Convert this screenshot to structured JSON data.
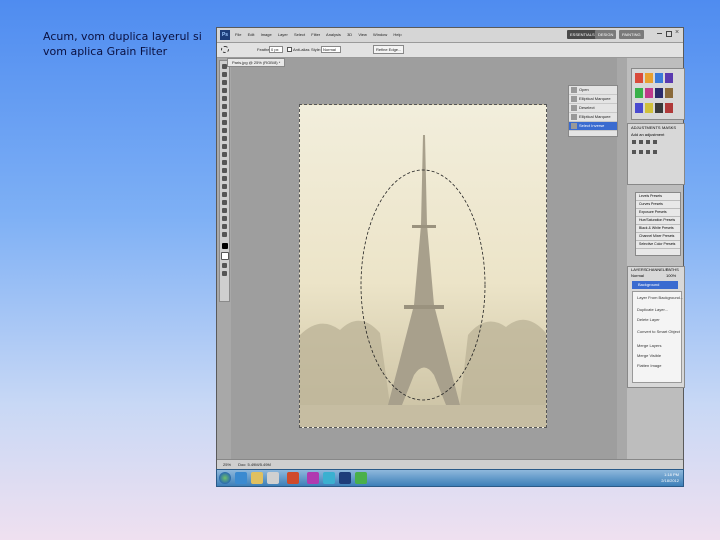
{
  "slide": {
    "text_line1": "Acum, vom duplica layerul si",
    "text_line2": "vom aplica Grain Filter"
  },
  "app": {
    "logo": "Ps",
    "menu": [
      "File",
      "Edit",
      "Image",
      "Layer",
      "Select",
      "Filter",
      "Analysis",
      "3D",
      "View",
      "Window",
      "Help"
    ],
    "workspace_buttons": [
      "ESSENTIALS",
      "DESIGN",
      "PAINTING"
    ],
    "options": {
      "feather_label": "Feather:",
      "feather_value": "0 px",
      "antialias_label": "Anti-alias",
      "style_label": "Style:",
      "style_value": "Normal",
      "refine_button": "Refine Edge..."
    },
    "document_tab": "Paris.jpg @ 25% (RGB/8) *",
    "status": {
      "zoom": "25%",
      "doc_size": "Doc: 5.49M/5.49M"
    }
  },
  "history_panel": {
    "items": [
      "Open",
      "Elliptical Marquee",
      "Deselect",
      "Elliptical Marquee",
      "Select Inverse"
    ],
    "active_index": 4
  },
  "adjustments_panel": {
    "tabs": [
      "ADJUSTMENTS",
      "MASKS"
    ],
    "title": "Add an adjustment"
  },
  "presets_list": {
    "items": [
      "Levels Presets",
      "Curves Presets",
      "Exposure Presets",
      "Hue/Saturation Presets",
      "Black & White Presets",
      "Channel Mixer Presets",
      "Selective Color Presets"
    ]
  },
  "layers_panel": {
    "tabs": [
      "LAYERS",
      "CHANNELS",
      "PATHS"
    ],
    "blend_mode": "Normal",
    "opacity": "100%",
    "selected_layer": "Background",
    "context_menu": [
      "Layer From Background...",
      "Duplicate Layer...",
      "Delete Layer",
      "Convert to Smart Object",
      "Merge Layers",
      "Merge Visible",
      "Flatten Image"
    ]
  },
  "taskbar": {
    "time": "1:18 PM",
    "date": "2/18/2012"
  },
  "colors": {
    "selection_blue": "#3a6bd0",
    "canvas_sepia": "#ece4c8"
  }
}
